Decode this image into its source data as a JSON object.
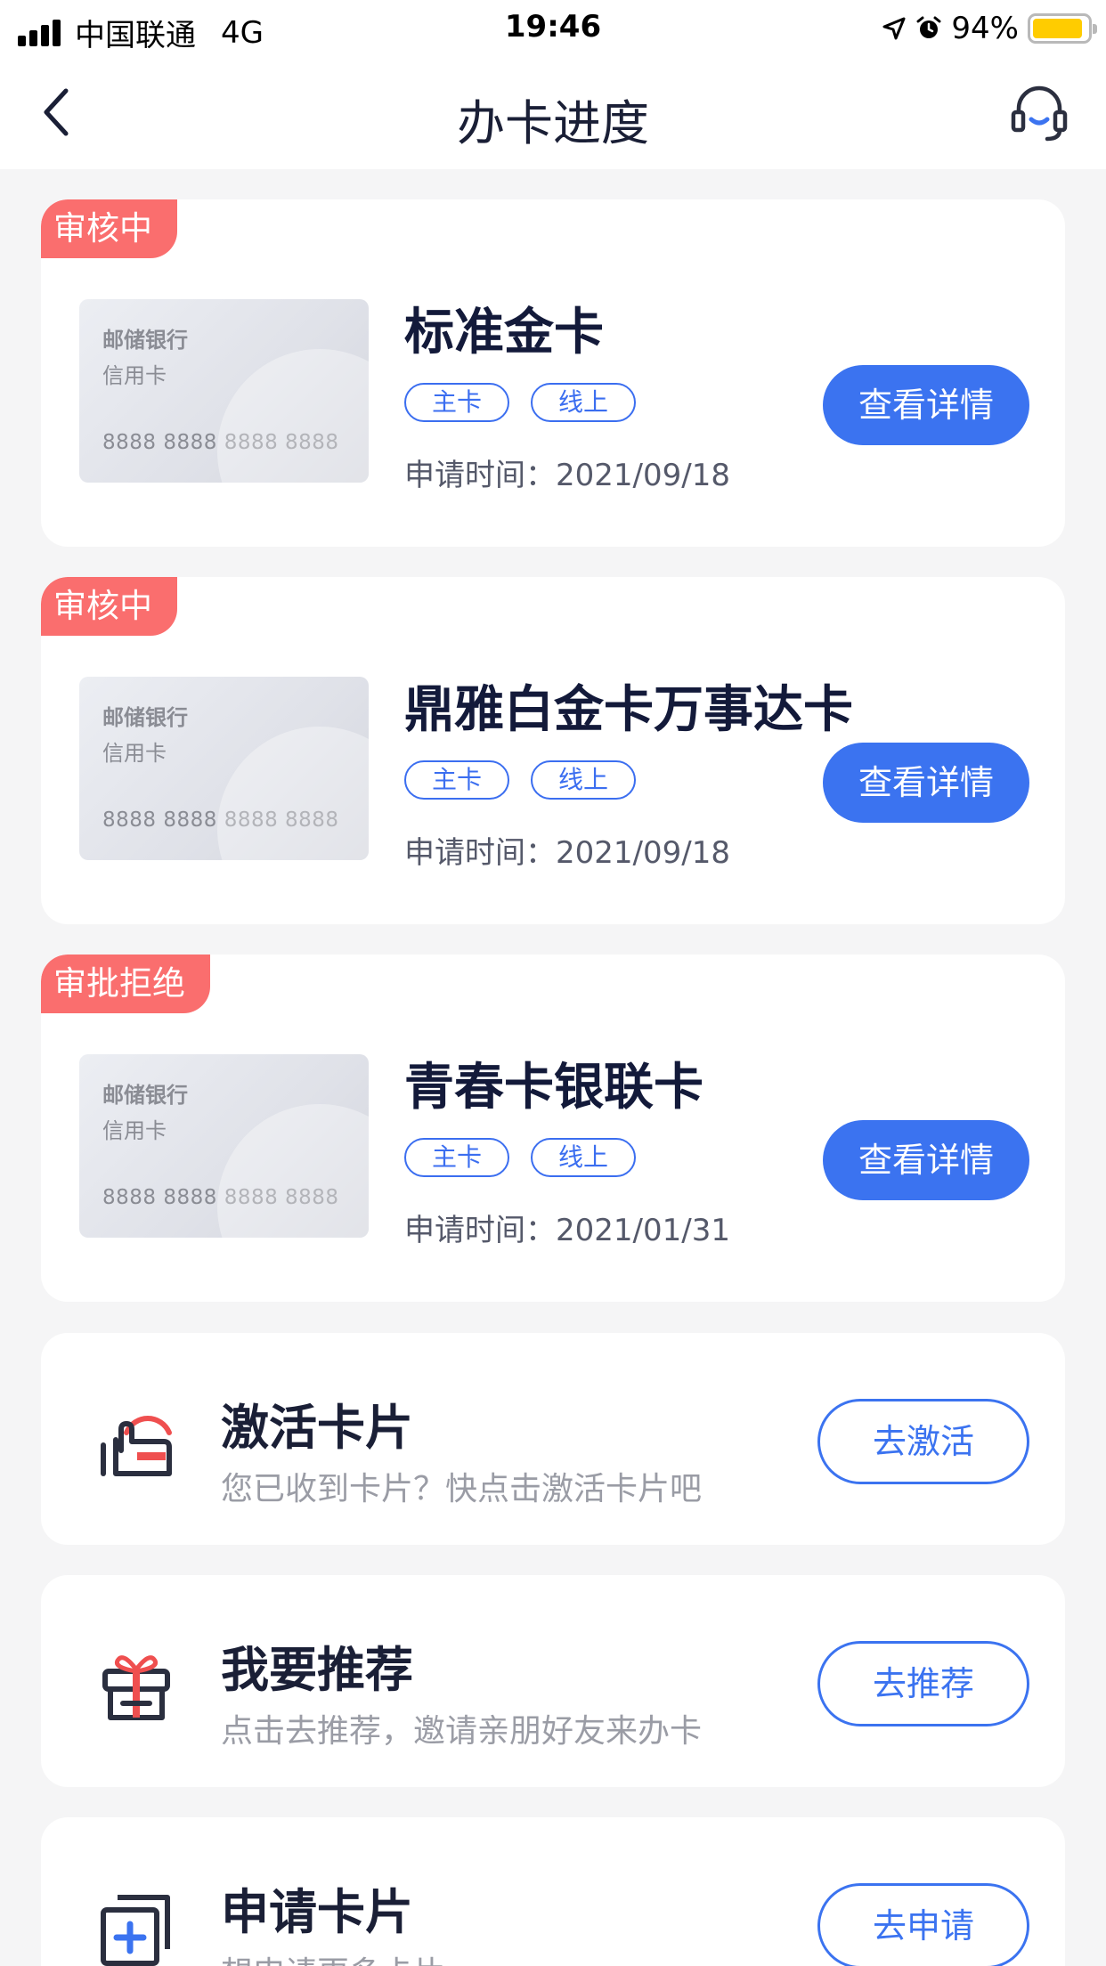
{
  "status_bar": {
    "carrier": "中国联通",
    "network": "4G",
    "time": "19:46",
    "battery": "94%"
  },
  "nav": {
    "title": "办卡进度"
  },
  "applications": [
    {
      "status": "审核中",
      "card_image": {
        "bank": "邮储银行",
        "type": "信用卡",
        "number": "8888 8888 8888 8888"
      },
      "name": "标准金卡",
      "tags": [
        "主卡",
        "线上"
      ],
      "apply_time": "申请时间：2021/09/18",
      "button": "查看详情"
    },
    {
      "status": "审核中",
      "card_image": {
        "bank": "邮储银行",
        "type": "信用卡",
        "number": "8888 8888 8888 8888"
      },
      "name": "鼎雅白金卡万事达卡",
      "tags": [
        "主卡",
        "线上"
      ],
      "apply_time": "申请时间：2021/09/18",
      "button": "查看详情"
    },
    {
      "status": "审批拒绝",
      "card_image": {
        "bank": "邮储银行",
        "type": "信用卡",
        "number": "8888 8888 8888 8888"
      },
      "name": "青春卡银联卡",
      "tags": [
        "主卡",
        "线上"
      ],
      "apply_time": "申请时间：2021/01/31",
      "button": "查看详情"
    }
  ],
  "actions": [
    {
      "icon": "hand-card-icon",
      "title": "激活卡片",
      "desc": "您已收到卡片？快点击激活卡片吧",
      "button": "去激活"
    },
    {
      "icon": "gift-icon",
      "title": "我要推荐",
      "desc": "点击去推荐，邀请亲朋好友来办卡",
      "button": "去推荐"
    },
    {
      "icon": "add-card-icon",
      "title": "申请卡片",
      "desc": "想申请更多卡片",
      "button": "去申请"
    }
  ],
  "colors": {
    "accent": "#3b73f0",
    "status_tag": "#fa6e6e",
    "background": "#f5f5f6"
  }
}
